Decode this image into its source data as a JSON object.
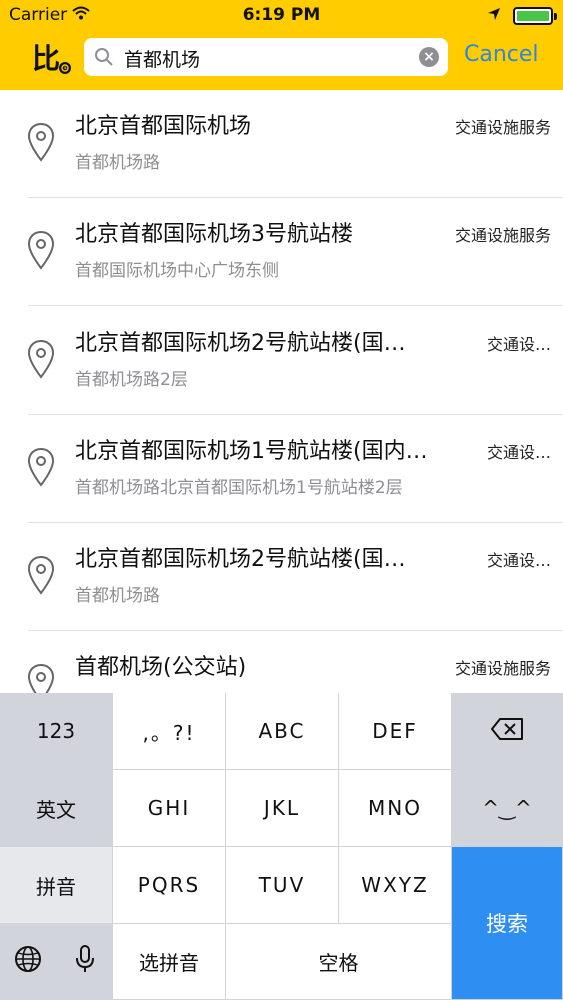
{
  "status": {
    "carrier": "Carrier",
    "time": "6:19 PM"
  },
  "search": {
    "value": "首都机场",
    "cancel_label": "Cancel"
  },
  "results": [
    {
      "title": "北京首都国际机场",
      "address": "首都机场路",
      "category": "交通设施服务"
    },
    {
      "title": "北京首都国际机场3号航站楼",
      "address": "首都国际机场中心广场东侧",
      "category": "交通设施服务"
    },
    {
      "title": "北京首都国际机场2号航站楼(国…",
      "address": "首都机场路2层",
      "category": "交通设…"
    },
    {
      "title": "北京首都国际机场1号航站楼(国内…",
      "address": "首都机场路北京首都国际机场1号航站楼2层",
      "category": "交通设…"
    },
    {
      "title": "北京首都国际机场2号航站楼(国…",
      "address": "首都机场路",
      "category": "交通设…"
    },
    {
      "title": "首都机场(公交站)",
      "address": "",
      "category": "交通设施服务"
    }
  ],
  "keyboard": {
    "numbers": "123",
    "punct": ",。?!",
    "abc": "ABC",
    "def": "DEF",
    "english": "英文",
    "ghi": "GHI",
    "jkl": "JKL",
    "mno": "MNO",
    "emoticon": "^‿^",
    "pinyin": "拼音",
    "pqrs": "PQRS",
    "tuv": "TUV",
    "wxyz": "WXYZ",
    "search": "搜索",
    "choose_pinyin": "选拼音",
    "space": "空格"
  },
  "colors": {
    "nav_bar": "#FFCC00",
    "accent": "#2E86DE",
    "search_key": "#2F8EF2"
  }
}
